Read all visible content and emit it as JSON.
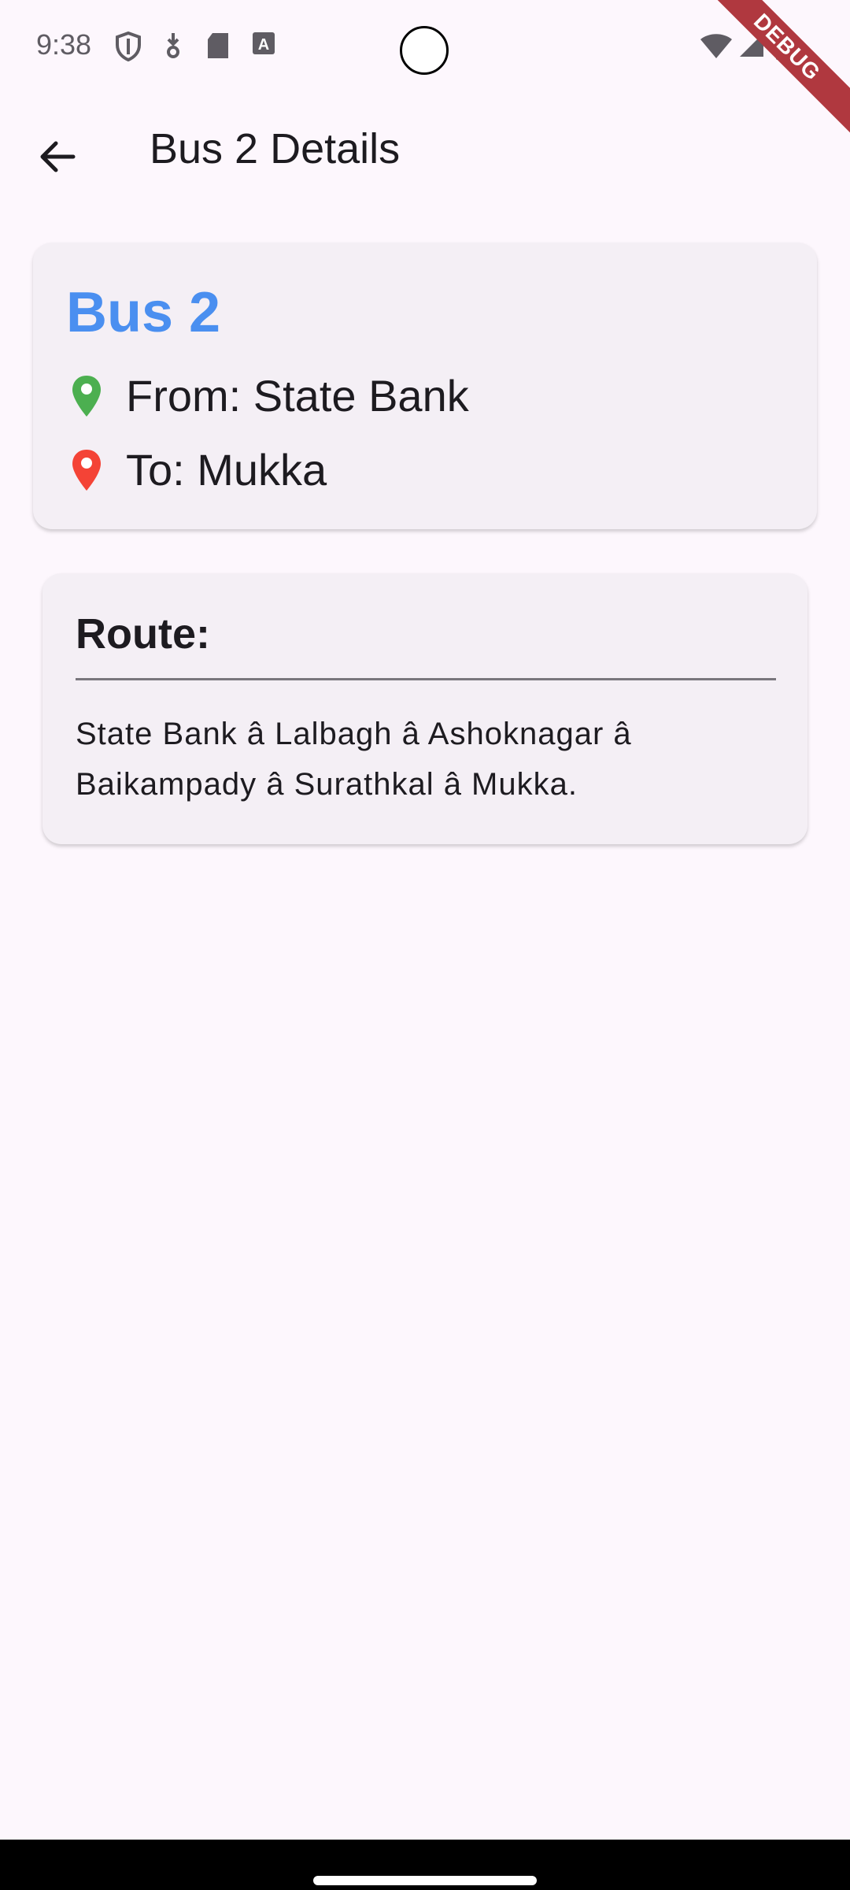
{
  "status_bar": {
    "time": "9:38",
    "left_icons": [
      "shield-icon",
      "download-icon",
      "sd-card-icon",
      "text-a-icon"
    ],
    "right_icons": [
      "wifi-icon",
      "signal-icon",
      "battery-icon"
    ],
    "debug_banner": "DEBUG"
  },
  "app_bar": {
    "back_icon": "arrow-back-icon",
    "title": "Bus 2 Details"
  },
  "bus_card": {
    "name": "Bus 2",
    "from": "From: State Bank",
    "to": "To: Mukka",
    "from_pin_color": "#4caf50",
    "to_pin_color": "#f44336",
    "name_color": "#4a8ff0"
  },
  "route_card": {
    "heading": "Route:",
    "text": "State Bank â Lalbagh â Ashoknagar â Baikampady â Surathkal â Mukka."
  }
}
